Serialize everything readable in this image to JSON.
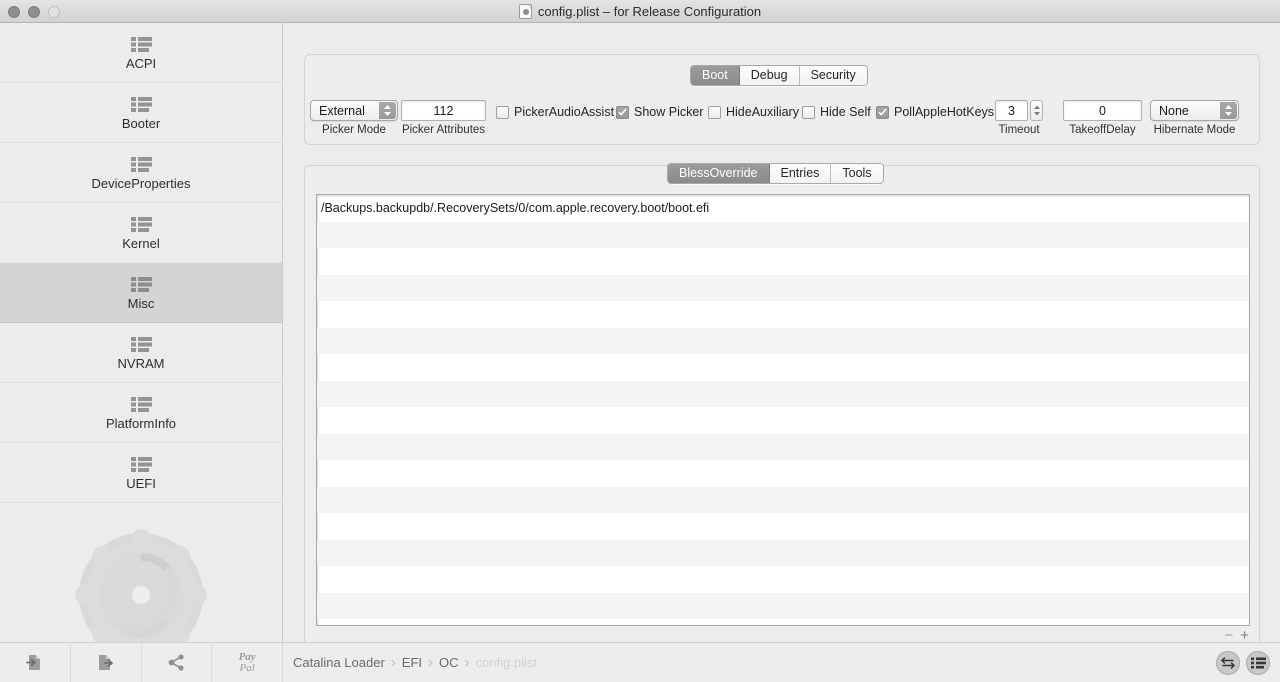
{
  "window": {
    "title": "config.plist – for Release Configuration",
    "doc_icon": "plist-document-icon",
    "traffic_lights": [
      "close",
      "minimize",
      "zoom"
    ]
  },
  "sidebar": {
    "items": [
      {
        "label": "ACPI",
        "icon": "list-icon",
        "selected": false
      },
      {
        "label": "Booter",
        "icon": "list-icon",
        "selected": false
      },
      {
        "label": "DeviceProperties",
        "icon": "list-icon",
        "selected": false
      },
      {
        "label": "Kernel",
        "icon": "list-icon",
        "selected": false
      },
      {
        "label": "Misc",
        "icon": "list-icon",
        "selected": true
      },
      {
        "label": "NVRAM",
        "icon": "list-icon",
        "selected": false
      },
      {
        "label": "PlatformInfo",
        "icon": "list-icon",
        "selected": false
      },
      {
        "label": "UEFI",
        "icon": "list-icon",
        "selected": false
      }
    ],
    "logo_icon": "gear-disc-logo"
  },
  "toolbar": {
    "buttons": [
      {
        "name": "import-button",
        "icon": "document-arrow-in-icon",
        "label": ""
      },
      {
        "name": "export-button",
        "icon": "document-arrow-out-icon",
        "label": ""
      },
      {
        "name": "share-button",
        "icon": "share-icon",
        "label": ""
      },
      {
        "name": "paypal-button",
        "icon": "paypal-icon",
        "label": "Pay",
        "label2": "Pal"
      }
    ]
  },
  "breadcrumb": {
    "items": [
      "Catalina Loader",
      "EFI",
      "OC",
      "config.plist"
    ],
    "separator": "›",
    "dim_last": true
  },
  "status_buttons": [
    {
      "name": "swap-arrows-button",
      "icon": "swap-arrows-icon"
    },
    {
      "name": "list-view-button",
      "icon": "list-icon"
    }
  ],
  "top_tabs": {
    "items": [
      "Boot",
      "Debug",
      "Security"
    ],
    "active": "Boot"
  },
  "controls": {
    "picker_mode": {
      "label": "Picker Mode",
      "value": "External",
      "type": "popup"
    },
    "picker_attrs": {
      "label": "Picker Attributes",
      "value": "112",
      "type": "text"
    },
    "timeout": {
      "label": "Timeout",
      "value": "3",
      "type": "stepper"
    },
    "takeoff_delay": {
      "label": "TakeoffDelay",
      "value": "0",
      "type": "text"
    },
    "hibernate_mode": {
      "label": "Hibernate Mode",
      "value": "None",
      "type": "popup"
    },
    "checkboxes": [
      {
        "label": "PickerAudioAssist",
        "checked": false
      },
      {
        "label": "Show Picker",
        "checked": true
      },
      {
        "label": "HideAuxiliary",
        "checked": false
      },
      {
        "label": "Hide Self",
        "checked": false
      },
      {
        "label": "PollAppleHotKeys",
        "checked": true
      }
    ]
  },
  "mid_tabs": {
    "items": [
      "BlessOverride",
      "Entries",
      "Tools"
    ],
    "active": "BlessOverride"
  },
  "table": {
    "rows": [
      "/Backups.backupdb/.RecoverySets/0/com.apple.recovery.boot/boot.efi",
      "",
      "",
      "",
      "",
      "",
      "",
      "",
      "",
      "",
      "",
      "",
      "",
      "",
      "",
      ""
    ],
    "add_label": "+",
    "remove_label": "−"
  },
  "colors": {
    "window_bg": "#ececec",
    "sidebar_selected": "#d4d4d4",
    "tab_active_bg": "#949494",
    "row_alt": "#f4f4f4"
  }
}
